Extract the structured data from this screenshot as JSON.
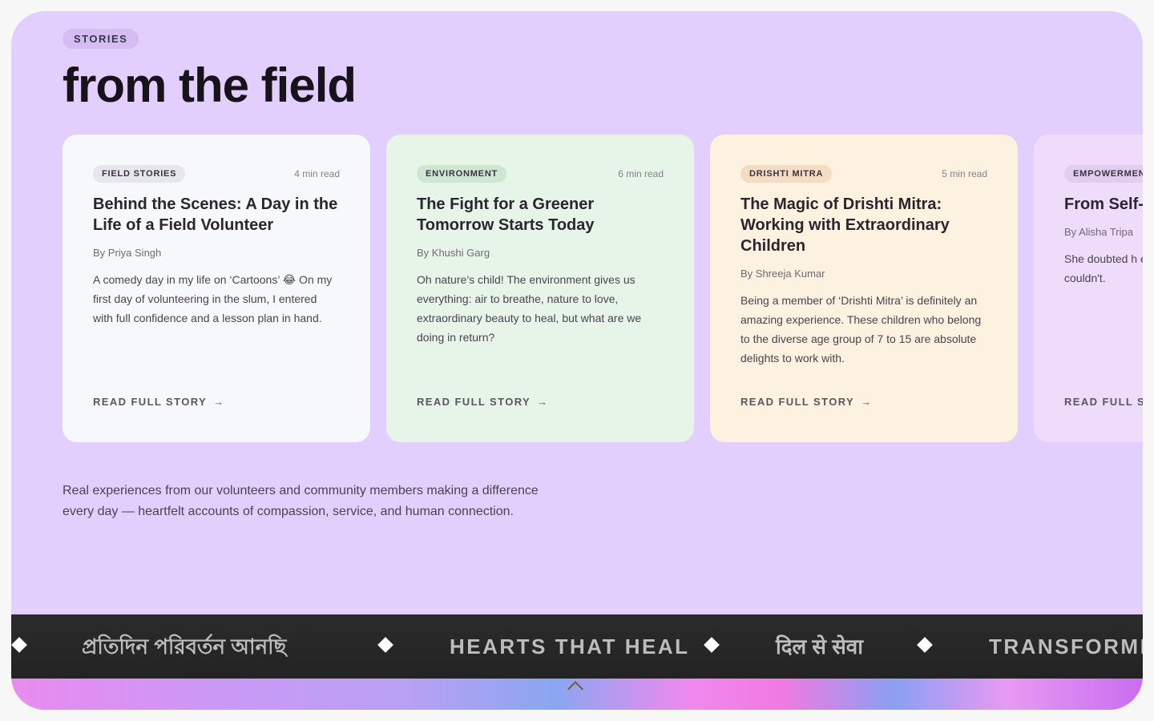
{
  "section": {
    "eyebrow": "STORIES",
    "title": "from the field",
    "intro": "Real experiences from our volunteers and community members making a difference every day — heartfelt accounts of compassion, service, and human connection."
  },
  "cards": [
    {
      "tag": "FIELD STORIES",
      "read_time": "4 min read",
      "title": "Behind the Scenes: A Day in the Life of a Field Volunteer",
      "author": "By Priya Singh",
      "excerpt": "A comedy day in my life on ‘Cartoons’ 😂 On my first day of volunteering in the slum, I entered with full confidence and a lesson plan in hand.",
      "cta": "READ FULL STORY",
      "bg": "#f7f8fc"
    },
    {
      "tag": "ENVIRONMENT",
      "read_time": "6 min read",
      "title": "The Fight for a Greener Tomorrow Starts Today",
      "author": "By Khushi Garg",
      "excerpt": "Oh nature’s child! The environment gives us everything: air to breathe, nature to love, extraordinary beauty to heal, but what are we doing in return?",
      "cta": "READ FULL STORY",
      "bg": "#e7f5e8"
    },
    {
      "tag": "DRISHTI MITRA",
      "read_time": "5 min read",
      "title": "The Magic of Drishti Mitra: Working with Extraordinary Children",
      "author": "By Shreeja Kumar",
      "excerpt": "Being a member of ‘Drishti Mitra’ is definitely an amazing experience. These children who belong to the diverse age group of 7 to 15 are absolute delights to work with.",
      "cta": "READ FULL STORY",
      "bg": "#fdf1df"
    },
    {
      "tag": "EMPOWERMEN",
      "read_time": "",
      "title": "From Self- Belief: A J Empowerr",
      "author": "By Alisha Tripa",
      "excerpt": "She doubted h every decisio and fear was l couldn't.",
      "cta": "READ FULL ST",
      "bg": "#efdcfa"
    }
  ],
  "marquee": {
    "items": [
      "প্রতিদিন পরিবর্তন আনছি",
      "HEARTS THAT HEAL",
      "दिल से सेवा",
      "TRANSFORMI"
    ]
  },
  "icons": {
    "arrow": "→",
    "scroll_up": "chevron-up-icon",
    "separator": "diamond-icon"
  }
}
